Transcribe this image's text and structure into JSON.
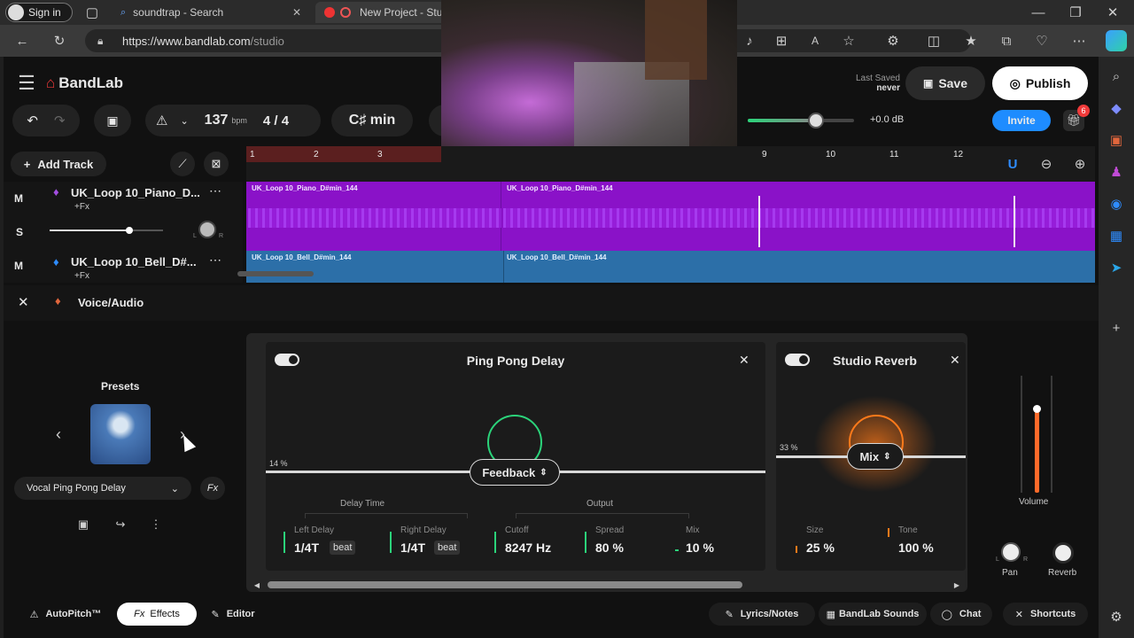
{
  "browser": {
    "signin_label": "Sign in",
    "tabs": [
      {
        "title": "soundtrap - Search"
      },
      {
        "title": "New Project - Stu"
      }
    ],
    "url_prefix": "https://www.bandlab.com",
    "url_path": "/studio"
  },
  "app": {
    "brand": "BandLab",
    "last_saved_label": "Last Saved",
    "last_saved_value": "never",
    "save_label": "Save",
    "publish_label": "Publish",
    "invite_label": "Invite",
    "notification_count": "6",
    "tempo": "137",
    "tempo_unit": "bpm",
    "time_signature": "4 / 4",
    "key": "C♯ min",
    "master_volume": "+0.0 dB",
    "add_track_label": "Add Track",
    "ruler_numbers": [
      "1",
      "2",
      "3",
      "9",
      "10",
      "11",
      "12"
    ],
    "tracks": [
      {
        "mute": "M",
        "solo": "S",
        "name": "UK_Loop 10_Piano_D...",
        "fx": "+Fx",
        "pan_l": "L",
        "pan_r": "R",
        "clip_1": "UK_Loop 10_Piano_D#min_144",
        "clip_2": "UK_Loop 10_Piano_D#min_144"
      },
      {
        "mute": "M",
        "name": "UK_Loop 10_Bell_D#...",
        "fx": "+Fx",
        "clip_1": "UK_Loop 10_Bell_D#min_144",
        "clip_2": "UK_Loop 10_Bell_D#min_144"
      }
    ],
    "editor_track_name": "Voice/Audio",
    "presets": {
      "title": "Presets",
      "selected": "Vocal Ping Pong Delay",
      "fx_label": "Fx"
    },
    "ping_pong": {
      "title": "Ping Pong Delay",
      "level": "14 %",
      "knob_label": "Feedback",
      "delay_group": "Delay Time",
      "output_group": "Output",
      "left_delay_label": "Left Delay",
      "left_delay_value": "1/4T",
      "left_delay_unit": "beat",
      "right_delay_label": "Right Delay",
      "right_delay_value": "1/4T",
      "right_delay_unit": "beat",
      "cutoff_label": "Cutoff",
      "cutoff_value": "8247 Hz",
      "spread_label": "Spread",
      "spread_value": "80 %",
      "mix_label": "Mix",
      "mix_value": "10 %"
    },
    "reverb": {
      "title": "Studio Reverb",
      "level": "33 %",
      "knob_label": "Mix",
      "size_label": "Size",
      "size_value": "25 %",
      "tone_label": "Tone",
      "tone_value": "100 %"
    },
    "channel": {
      "volume_label": "Volume",
      "pan_label": "Pan",
      "reverb_label": "Reverb",
      "pan_l": "L",
      "pan_r": "R"
    },
    "bottom": {
      "autopitch": "AutoPitch™",
      "effects": "Effects",
      "editor": "Editor",
      "lyrics": "Lyrics/Notes",
      "sounds": "BandLab Sounds",
      "chat": "Chat",
      "shortcuts": "Shortcuts"
    }
  },
  "colors": {
    "purple_clip": "#8a12c8",
    "blue_clip": "#2c6fa8",
    "accent_blue": "#1e8cff",
    "green_knob": "#2bd37a",
    "orange_glow": "#ff7a1a",
    "ruler_red": "#5b1f1f"
  }
}
